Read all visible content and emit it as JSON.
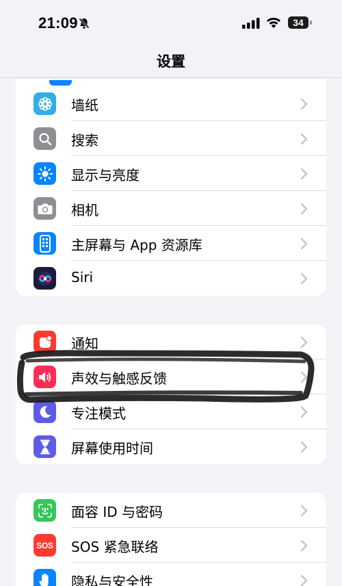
{
  "status_bar": {
    "time": "21:09",
    "battery": "34",
    "icons": [
      "bell-slash-icon",
      "cellular-signal-icon",
      "wifi-icon",
      "battery-icon"
    ]
  },
  "nav": {
    "title": "设置"
  },
  "groups": [
    {
      "rows": [
        {
          "label": "墙纸",
          "icon": "wallpaper-icon",
          "color": "#32ade6"
        },
        {
          "label": "搜索",
          "icon": "search-icon",
          "color": "#8e8e93"
        },
        {
          "label": "显示与亮度",
          "icon": "brightness-icon",
          "color": "#0a84ff"
        },
        {
          "label": "相机",
          "icon": "camera-icon",
          "color": "#8e8e93"
        },
        {
          "label": "主屏幕与 App 资源库",
          "icon": "home-screen-icon",
          "color": "#0a84ff"
        },
        {
          "label": "Siri",
          "icon": "siri-icon",
          "color": "#1c1c3a"
        }
      ]
    },
    {
      "rows": [
        {
          "label": "通知",
          "icon": "notification-icon",
          "color": "#ff3b30"
        },
        {
          "label": "声效与触感反馈",
          "icon": "speaker-icon",
          "color": "#ff2d55"
        },
        {
          "label": "专注模式",
          "icon": "moon-icon",
          "color": "#5e5ce6"
        },
        {
          "label": "屏幕使用时间",
          "icon": "hourglass-icon",
          "color": "#5e5ce6"
        }
      ]
    },
    {
      "rows": [
        {
          "label": "面容 ID 与密码",
          "icon": "face-id-icon",
          "color": "#34c759"
        },
        {
          "label": "SOS 紧急联络",
          "icon": "sos-icon",
          "color": "#ff3b30",
          "badge_text": "SOS"
        },
        {
          "label": "隐私与安全性",
          "icon": "hand-icon",
          "color": "#0a84ff"
        }
      ]
    }
  ]
}
